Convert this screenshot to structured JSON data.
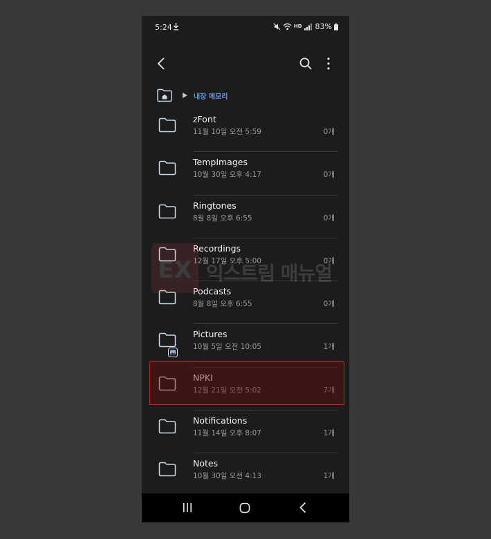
{
  "status_bar": {
    "time": "5:24",
    "hd_label": "HD",
    "battery": "83%"
  },
  "toolbar": {
    "back_icon": "chevron-left-icon",
    "search_icon": "search-icon",
    "more_icon": "more-vertical-icon"
  },
  "breadcrumb": {
    "home_icon": "folder-home-icon",
    "current": "내장 메모리"
  },
  "folders": [
    {
      "name": "zFont",
      "date": "11월 10일 오전 5:59",
      "count": "0개"
    },
    {
      "name": "TempImages",
      "date": "10월 30일 오후 4:17",
      "count": "0개"
    },
    {
      "name": "Ringtones",
      "date": "8월 8일 오후 6:55",
      "count": "0개"
    },
    {
      "name": "Recordings",
      "date": "12월 17일 오후 5:00",
      "count": "0개"
    },
    {
      "name": "Podcasts",
      "date": "8월 8일 오후 6:55",
      "count": "0개"
    },
    {
      "name": "Pictures",
      "date": "10월 5일 오전 10:05",
      "count": "1개"
    },
    {
      "name": "NPKI",
      "date": "12월 21일 오전 5:02",
      "count": "7개"
    },
    {
      "name": "Notifications",
      "date": "11월 14일 오후 8:07",
      "count": "1개"
    },
    {
      "name": "Notes",
      "date": "10월 30일 오전 4:13",
      "count": "1개"
    }
  ],
  "highlighted_folder": "NPKI",
  "watermark": {
    "mark": "EX",
    "text": "익스트림 매뉴얼"
  },
  "colors": {
    "background": "#383838",
    "screen": "#1c1c1d",
    "accent": "#5a9bf0",
    "highlight_border": "#d11f1f",
    "folder_outline": "#c9d8e6"
  }
}
